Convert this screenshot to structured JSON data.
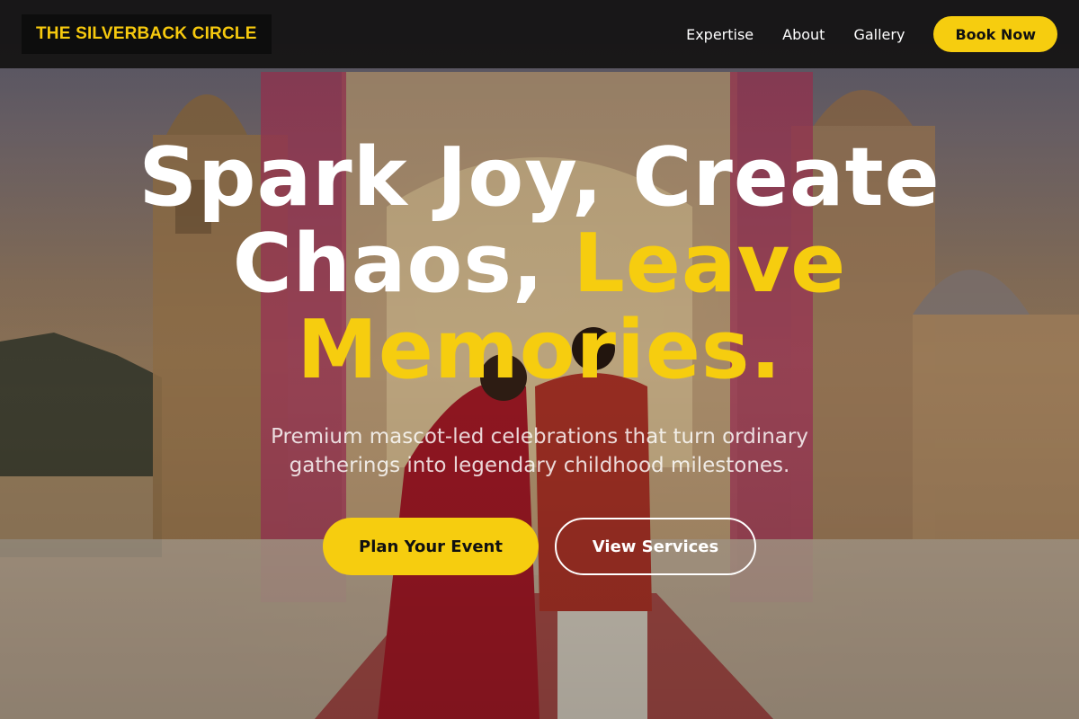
{
  "header": {
    "logo_text": "THE SILVERBACK CIRCLE",
    "nav": [
      {
        "label": "Expertise"
      },
      {
        "label": "About"
      },
      {
        "label": "Gallery"
      }
    ],
    "cta_label": "Book Now"
  },
  "hero": {
    "headline_line1": "Spark Joy, Create",
    "headline_line2_plain": "Chaos, ",
    "headline_line2_accent": "Leave",
    "headline_line3_accent": "Memories.",
    "subheadline": "Premium mascot-led celebrations that turn ordinary gatherings into legendary childhood milestones.",
    "primary_cta": "Plan Your Event",
    "secondary_cta": "View Services",
    "background_image": "wedding-couple-palace-floral-arch-photo"
  },
  "colors": {
    "accent": "#f6cd0f",
    "header_bg": "#141212",
    "text_light": "#ffffff"
  }
}
